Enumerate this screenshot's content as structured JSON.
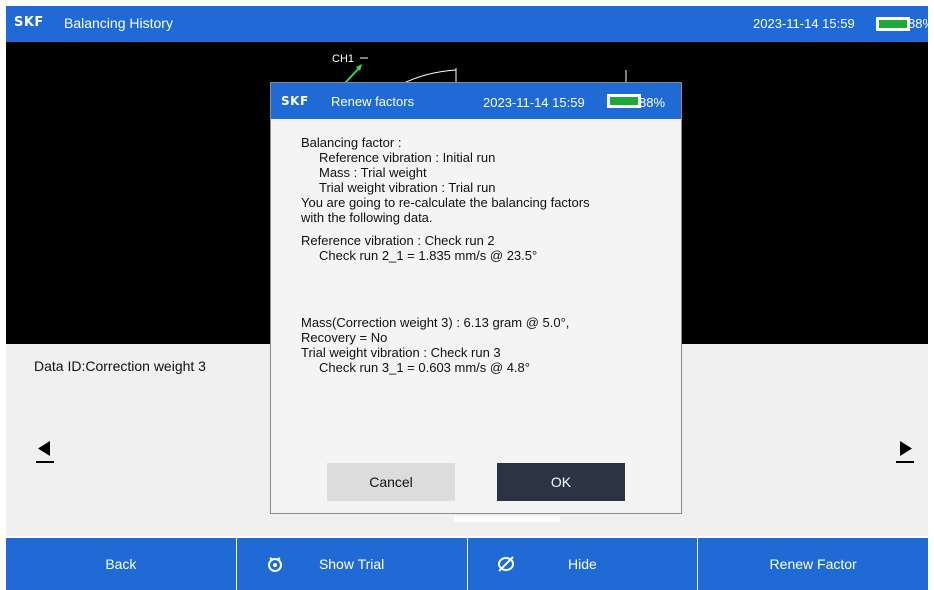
{
  "app": {
    "brand": "SKF",
    "title": "Balancing History",
    "datetime": "2023-11-14 15:59",
    "battery_percent": 88,
    "battery_label": "88%"
  },
  "plot": {
    "channel_label": "CH1"
  },
  "info": {
    "data_id": "Data ID:Correction weight 3"
  },
  "dialog": {
    "brand": "SKF",
    "title": "Renew factors",
    "datetime": "2023-11-14 15:59",
    "battery_percent": 88,
    "battery_label": "88%",
    "lines": {
      "l1": "Balancing factor :",
      "l2": "Reference vibration : Initial run",
      "l3": "Mass : Trial weight",
      "l4": "Trial weight vibration : Trial run",
      "l5": "You are going to re-calculate the balancing factors",
      "l6": "with the following data.",
      "l7": "Reference vibration : Check run 2",
      "l8": "Check run 2_1 = 1.835 mm/s @ 23.5°",
      "l9": "Mass(Correction weight 3) : 6.13 gram @ 5.0°,",
      "l10": "Recovery = No",
      "l11": "Trial weight vibration : Check run 3",
      "l12": "Check run 3_1 = 0.603 mm/s @ 4.8°"
    },
    "cancel_label": "Cancel",
    "ok_label": "OK"
  },
  "bottom": {
    "back_label": "Back",
    "show_trial_label": "Show Trial",
    "hide_label": "Hide",
    "renew_factor_label": "Renew Factor"
  },
  "colors": {
    "accent": "#1f6ad4",
    "battery_fill": "#1fa83a",
    "ok_button": "#2b3442"
  },
  "icons": {
    "prev": "triangle-left-icon",
    "next": "triangle-right-icon",
    "show_trial": "eye-target-icon",
    "hide": "eye-slash-icon"
  }
}
